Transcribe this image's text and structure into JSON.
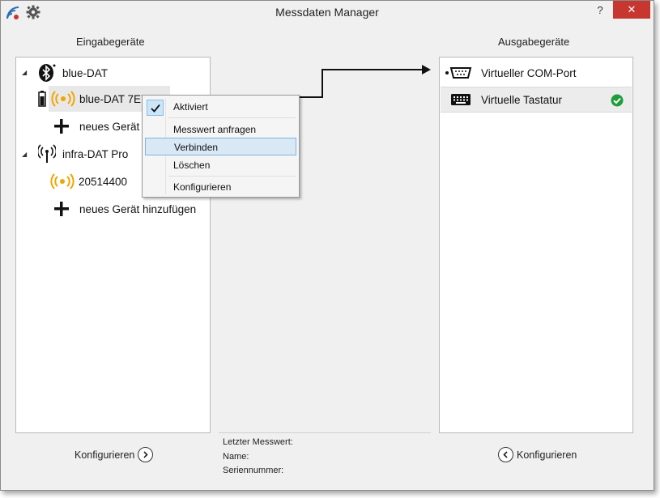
{
  "window": {
    "title": "Messdaten Manager",
    "help_label": "?",
    "close_label": "✕"
  },
  "icons": {
    "app": "wifi-signal-app-icon",
    "settings": "gear-icon",
    "accent_red": "#c7372f",
    "signal_orange": "#f0a500",
    "check_green": "#1e9e3a"
  },
  "input_panel": {
    "title": "Eingabegeräte",
    "groups": [
      {
        "name": "blue-DAT",
        "icon": "bluetooth-icon",
        "children": [
          {
            "label": "blue-DAT 7E7E1",
            "icon": "signal-icon",
            "battery_icon": "battery-icon"
          },
          {
            "label": "neues Gerät hinzufügen",
            "icon": "plus-icon"
          }
        ]
      },
      {
        "name": "infra-DAT Pro",
        "icon": "antenna-icon",
        "children": [
          {
            "label": "20514400",
            "icon": "signal-icon"
          },
          {
            "label": "neues Gerät hinzufügen",
            "icon": "plus-icon"
          }
        ]
      }
    ],
    "configure_label": "Konfigurieren"
  },
  "output_panel": {
    "title": "Ausgabegeräte",
    "items": [
      {
        "label": "Virtueller COM-Port",
        "icon": "serial-port-icon"
      },
      {
        "label": "Virtuelle Tastatur",
        "icon": "keyboard-icon",
        "status": "active"
      }
    ],
    "configure_label": "Konfigurieren"
  },
  "info": {
    "last_value_label": "Letzter Messwert:",
    "name_label": "Name:",
    "serial_label": "Seriennummer:"
  },
  "context_menu": {
    "items": [
      {
        "label": "Aktiviert",
        "checked": true
      },
      {
        "label": "Messwert anfragen"
      },
      {
        "label": "Verbinden",
        "highlighted": true
      },
      {
        "label": "Löschen"
      },
      {
        "label": "Konfigurieren"
      }
    ]
  }
}
